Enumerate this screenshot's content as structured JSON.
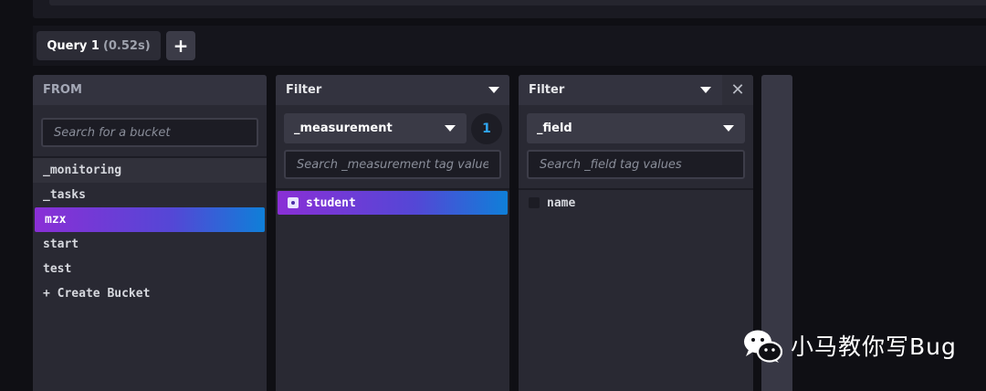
{
  "query_tabs": {
    "active_tab": {
      "label": "Query 1",
      "time": "(0.52s)"
    },
    "add_label": "+"
  },
  "from_panel": {
    "title": "FROM",
    "search_placeholder": "Search for a bucket",
    "buckets": [
      "_monitoring",
      "_tasks",
      "mzx",
      "start",
      "test"
    ],
    "selected_bucket": "mzx",
    "create_label": "+ Create Bucket"
  },
  "filter1": {
    "title": "Filter",
    "key": "_measurement",
    "selected_count": "1",
    "search_placeholder": "Search _measurement tag values",
    "values": [
      {
        "label": "student",
        "checked": true
      }
    ]
  },
  "filter2": {
    "title": "Filter",
    "key": "_field",
    "close_label": "✕",
    "search_placeholder": "Search _field tag values",
    "values": [
      {
        "label": "name",
        "checked": false
      }
    ]
  },
  "watermark": {
    "text": "小马教你写Bug"
  },
  "icons": {
    "caret": "chevron-down-icon",
    "close": "close-icon",
    "wechat": "wechat-icon"
  },
  "colors": {
    "background": "#0f0f14",
    "panel": "#292933",
    "panel_header": "#33333f",
    "selected_gradient_start": "#8a2fd6",
    "selected_gradient_end": "#0f7fd8",
    "badge_text": "#2fa6f0"
  }
}
